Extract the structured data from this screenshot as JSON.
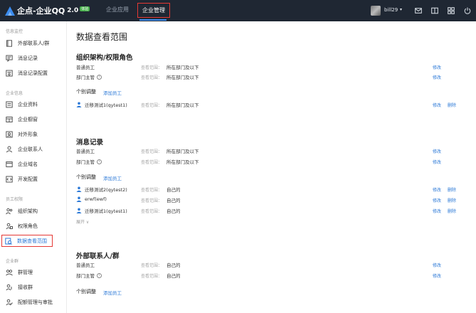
{
  "colors": {
    "topbar_bg": "#1f2733",
    "accent": "#2c79d7",
    "highlight": "#e53935",
    "logo_badge": "#47b04b"
  },
  "topbar": {
    "logo_text": "企点-企业QQ",
    "logo_version": "2.0",
    "logo_badge": "体验",
    "nav_apps": "企业应用",
    "nav_manage": "企业管理",
    "username": "bill29",
    "caret": "▾",
    "icons": [
      "mail-icon",
      "book-icon",
      "apps-grid-icon",
      "logout-icon"
    ]
  },
  "sidebar": {
    "groups": [
      {
        "title": "信息监控",
        "items": [
          {
            "label": "外部联系人/群",
            "icon": "contacts-book-icon"
          },
          {
            "label": "消息记录",
            "icon": "message-record-icon"
          },
          {
            "label": "消息记录配置",
            "icon": "message-config-icon"
          }
        ]
      },
      {
        "title": "企业信息",
        "items": [
          {
            "label": "企业资料",
            "icon": "company-info-icon"
          },
          {
            "label": "企业橱窗",
            "icon": "showcase-icon"
          },
          {
            "label": "对外形象",
            "icon": "public-image-icon"
          },
          {
            "label": "企业联系人",
            "icon": "contact-person-icon"
          },
          {
            "label": "企业域名",
            "icon": "domain-icon"
          },
          {
            "label": "开发配置",
            "icon": "dev-config-icon"
          }
        ]
      },
      {
        "title": "员工权限",
        "items": [
          {
            "label": "组织架构",
            "icon": "org-chart-icon"
          },
          {
            "label": "权限角色",
            "icon": "role-icon"
          },
          {
            "label": "数据查看范围",
            "icon": "data-scope-icon"
          }
        ]
      },
      {
        "title": "企业群",
        "items": [
          {
            "label": "群管理",
            "icon": "group-manage-icon"
          },
          {
            "label": "接收群",
            "icon": "receive-group-icon"
          },
          {
            "label": "配额管理与审批",
            "icon": "quota-icon"
          }
        ]
      }
    ]
  },
  "main": {
    "title": "数据查看范围",
    "scope_label": "查看范围：",
    "edit": "修改",
    "delete": "删除",
    "adjust_title": "个别调整",
    "add_staff": "添加员工",
    "sections": [
      {
        "title": "组织架构/权限角色",
        "rows": [
          {
            "label": "普通员工",
            "info": false,
            "scope": "所在部门及以下"
          },
          {
            "label": "部门主管",
            "info": true,
            "scope": "所在部门及以下"
          }
        ],
        "members": [
          {
            "name": "迁移测试1(qytest1)",
            "scope": "所在部门及以下"
          }
        ]
      },
      {
        "title": "消息记录",
        "rows": [
          {
            "label": "普通员工",
            "info": false,
            "scope": "所在部门及以下"
          },
          {
            "label": "部门主管",
            "info": true,
            "scope": "所在部门及以下"
          }
        ],
        "members": [
          {
            "name": "迁移测试2(qytest2)",
            "scope": "自己的"
          },
          {
            "name": "erwf(ewf)",
            "scope": "自己的"
          },
          {
            "name": "迁移测试1(qytest1)",
            "scope": "自己的"
          }
        ],
        "expand": "展开 ∨"
      },
      {
        "title": "外部联系人/群",
        "rows": [
          {
            "label": "普通员工",
            "info": false,
            "scope": "自己的"
          },
          {
            "label": "部门主管",
            "info": true,
            "scope": "自己的"
          }
        ],
        "members": []
      }
    ]
  }
}
